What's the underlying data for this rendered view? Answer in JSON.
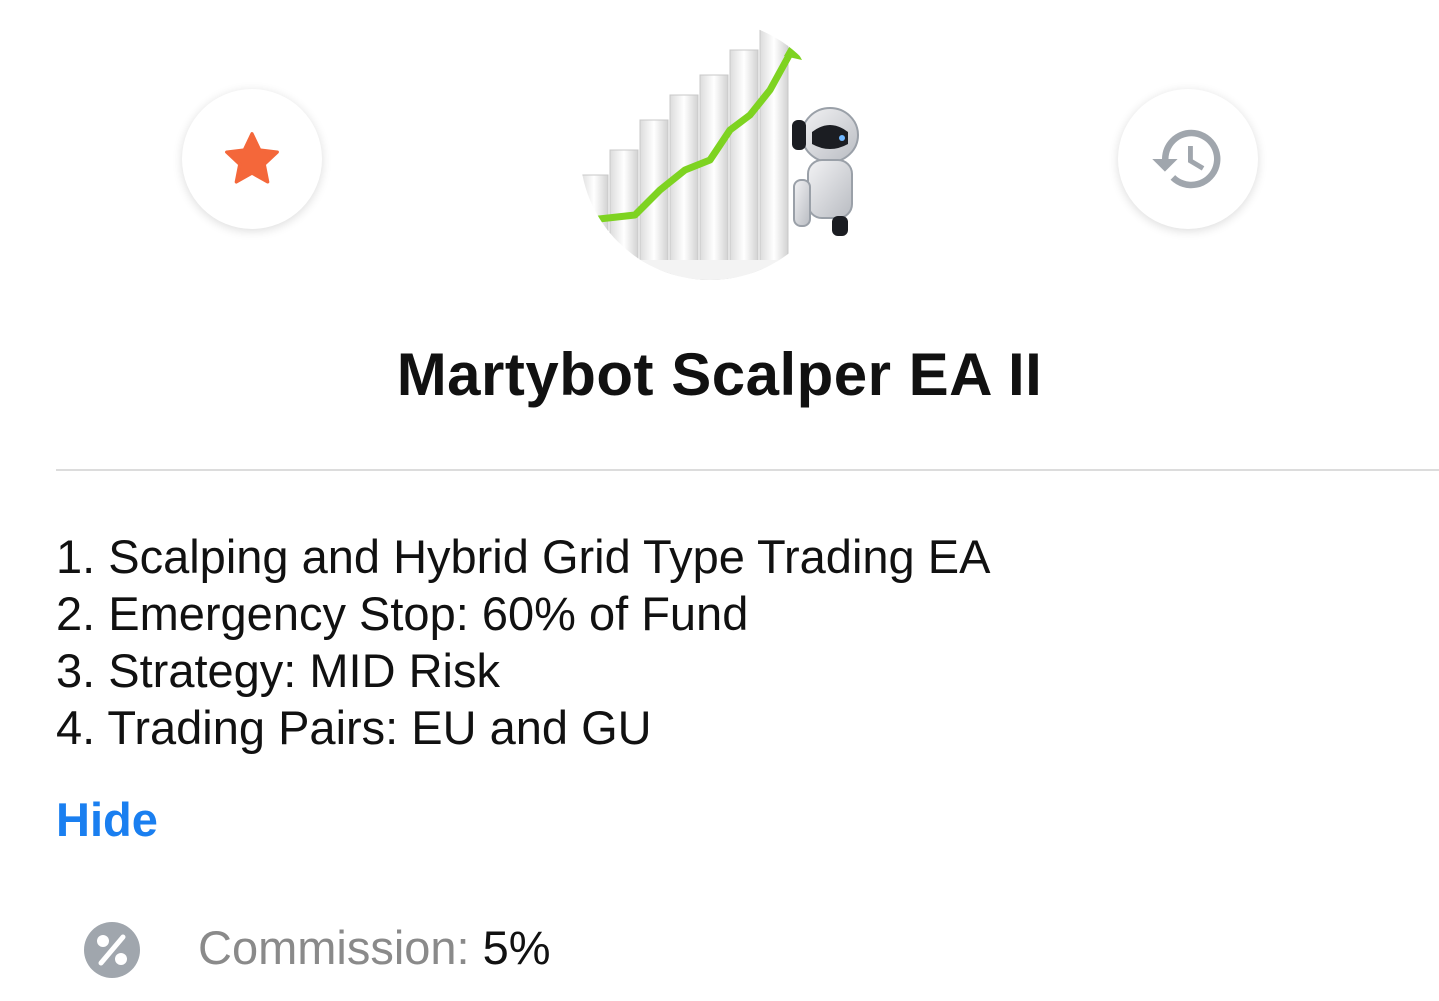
{
  "product": {
    "title": "Martybot Scalper EA II"
  },
  "actions": {
    "favorite_icon": "star-icon",
    "history_icon": "history-icon"
  },
  "description": {
    "items": [
      "1. Scalping and Hybrid Grid Type Trading EA",
      "2. Emergency Stop: 60% of Fund",
      "3. Strategy: MID Risk",
      "4. Trading Pairs: EU and GU"
    ],
    "toggle_label": "Hide"
  },
  "commission": {
    "label": "Commission: ",
    "value": "5%",
    "icon": "percent-icon"
  },
  "colors": {
    "accent": "#1a7ff0",
    "star": "#f4673a",
    "icon_gray": "#a0a6ad"
  }
}
